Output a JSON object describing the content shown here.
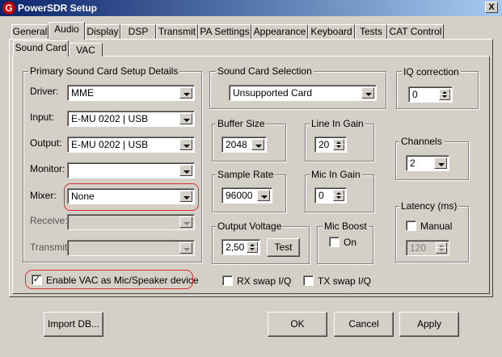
{
  "window": {
    "title": "PowerSDR Setup",
    "icon": "G",
    "close": "X"
  },
  "tabs": [
    "General",
    "Audio",
    "Display",
    "DSP",
    "Transmit",
    "PA Settings",
    "Appearance",
    "Keyboard",
    "Tests",
    "CAT Control"
  ],
  "active_tab": "Audio",
  "subtabs": [
    "Sound Card",
    "VAC"
  ],
  "active_subtab": "Sound Card",
  "primary": {
    "title": "Primary Sound Card Setup Details",
    "driver_label": "Driver:",
    "driver_value": "MME",
    "input_label": "Input:",
    "input_value": "E-MU 0202 | USB",
    "output_label": "Output:",
    "output_value": "E-MU 0202 | USB",
    "monitor_label": "Monitor:",
    "monitor_value": "",
    "mixer_label": "Mixer:",
    "mixer_value": "None",
    "receive_label": "Receive:",
    "receive_value": "",
    "transmit_label": "Transmit:",
    "transmit_value": ""
  },
  "sound_card_selection": {
    "title": "Sound Card Selection",
    "value": "Unsupported Card"
  },
  "iq_correction": {
    "title": "IQ correction",
    "value": "0"
  },
  "buffer_size": {
    "title": "Buffer Size",
    "value": "2048"
  },
  "line_in_gain": {
    "title": "Line In Gain",
    "value": "20"
  },
  "channels": {
    "title": "Channels",
    "value": "2"
  },
  "sample_rate": {
    "title": "Sample Rate",
    "value": "96000"
  },
  "mic_in_gain": {
    "title": "Mic In Gain",
    "value": "0"
  },
  "latency": {
    "title": "Latency (ms)",
    "manual_label": "Manual",
    "manual_checked": false,
    "value": "120"
  },
  "output_voltage": {
    "title": "Output Voltage",
    "value": "2,50",
    "test_label": "Test"
  },
  "mic_boost": {
    "title": "Mic Boost",
    "on_label": "On",
    "checked": false
  },
  "enable_vac": {
    "label": "Enable VAC as Mic/Speaker device",
    "checked": true
  },
  "rx_swap": {
    "label": "RX swap I/Q",
    "checked": false
  },
  "tx_swap": {
    "label": "TX swap I/Q",
    "checked": false
  },
  "buttons": {
    "import": "Import DB...",
    "ok": "OK",
    "cancel": "Cancel",
    "apply": "Apply"
  },
  "colors": {
    "titlebar_start": "#0a246a",
    "titlebar_end": "#a6caf0",
    "face": "#d4d0c8",
    "highlight": "#d83030"
  }
}
